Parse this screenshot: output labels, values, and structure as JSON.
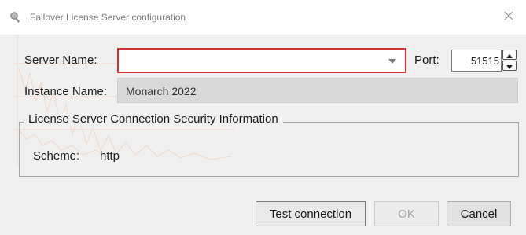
{
  "window": {
    "title": "Failover License Server configuration",
    "icon": "key-search-icon",
    "close_icon": "close-icon"
  },
  "form": {
    "server_name_label": "Server Name:",
    "server_name_value": "",
    "port_label": "Port:",
    "port_value": "51515",
    "instance_name_label": "Instance Name:",
    "instance_name_value": "Monarch 2022"
  },
  "security_group": {
    "legend": "License Server Connection Security Information",
    "scheme_label": "Scheme:",
    "scheme_value": "http"
  },
  "buttons": {
    "test_connection": "Test connection",
    "ok": "OK",
    "cancel": "Cancel"
  },
  "colors": {
    "error_border": "#d13438",
    "dialog_bg": "#f0f0f0",
    "readonly_field_bg": "#d9d9d9"
  }
}
